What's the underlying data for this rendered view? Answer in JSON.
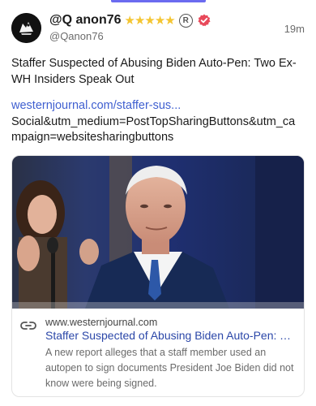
{
  "post": {
    "author_name": "@Q anon76",
    "stars": "★★★★★",
    "registered_mark": "R",
    "handle": "@Qanon76",
    "time": "19m",
    "text": "Staffer Suspected of Abusing Biden Auto-Pen: Two Ex-WH Insiders Speak Out",
    "link_text": "westernjournal.com/staffer-sus...",
    "link_continuation": "Social&utm_medium=PostTopSharingButtons&utm_campaign=websitesharingbuttons"
  },
  "link_card": {
    "image_alt": "Photo of Joe Biden",
    "domain": "www.westernjournal.com",
    "title": "Staffer Suspected of Abusing Biden Auto-Pen: Two Ex-WH Insiders Speak Out",
    "description": "A new report alleges that a staff member used an autopen to sign documents President Joe Biden did not know were being signed."
  },
  "colors": {
    "accent": "#6b6bf0",
    "link": "#3f5fd0",
    "verified_badge": "#e8495a",
    "stars": "#f4c531"
  },
  "icons": {
    "verified": "verified-badge-icon",
    "link": "link-icon"
  }
}
